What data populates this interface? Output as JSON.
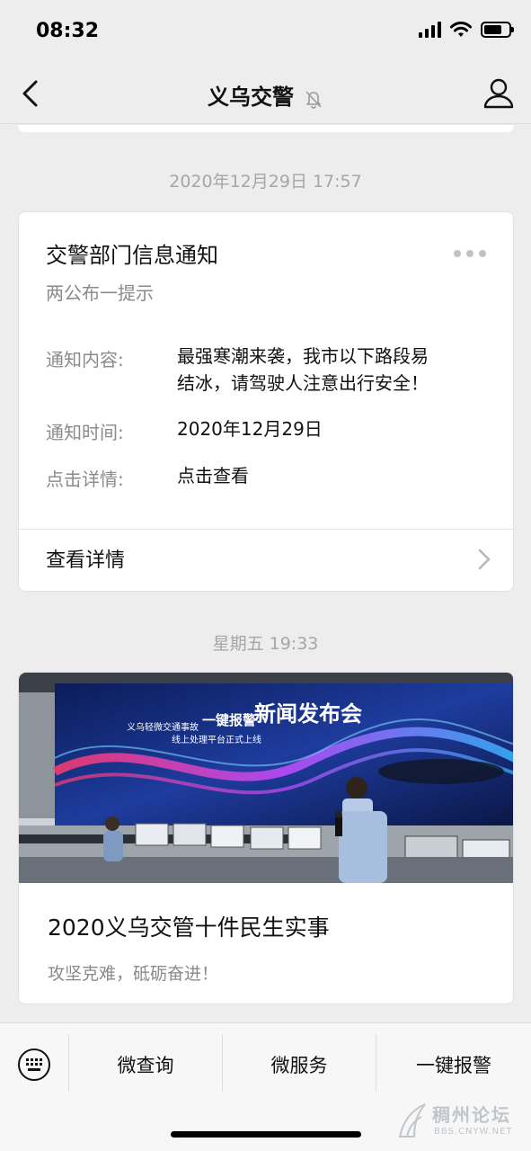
{
  "status_bar": {
    "time": "08:32"
  },
  "nav": {
    "title": "义乌交警"
  },
  "messages": [
    {
      "timestamp": "2020年12月29日 17:57",
      "card": {
        "title": "交警部门信息通知",
        "subtitle": "两公布一提示",
        "fields": [
          {
            "label": "通知内容:",
            "value_line1": "最强寒潮来袭，我市以下路段易",
            "value_line2": "结冰，请驾驶人注意出行安全！"
          },
          {
            "label": "通知时间:",
            "value": "2020年12月29日"
          },
          {
            "label": "点击详情:",
            "value": "点击查看"
          }
        ],
        "link_label": "查看详情"
      }
    },
    {
      "timestamp": "星期五 19:33",
      "article": {
        "image_banner_small_line1": "义乌轻微交通事故",
        "image_banner_highlight": "一键报警",
        "image_banner_small_line2": "线上处理平台正式上线",
        "image_banner_big": "新闻发布会",
        "title": "2020义乌交管十件民生实事",
        "description": "攻坚克难，砥砺奋进！"
      }
    }
  ],
  "bottom_menu": {
    "items": [
      "微查询",
      "微服务",
      "一键报警"
    ]
  },
  "watermark": {
    "text": "稠州论坛",
    "url": "BBS.CNYW.NET"
  },
  "colors": {
    "background": "#ededed",
    "card": "#ffffff",
    "secondary_text": "#8a8a8a",
    "timestamp_text": "#a6a6a6"
  }
}
